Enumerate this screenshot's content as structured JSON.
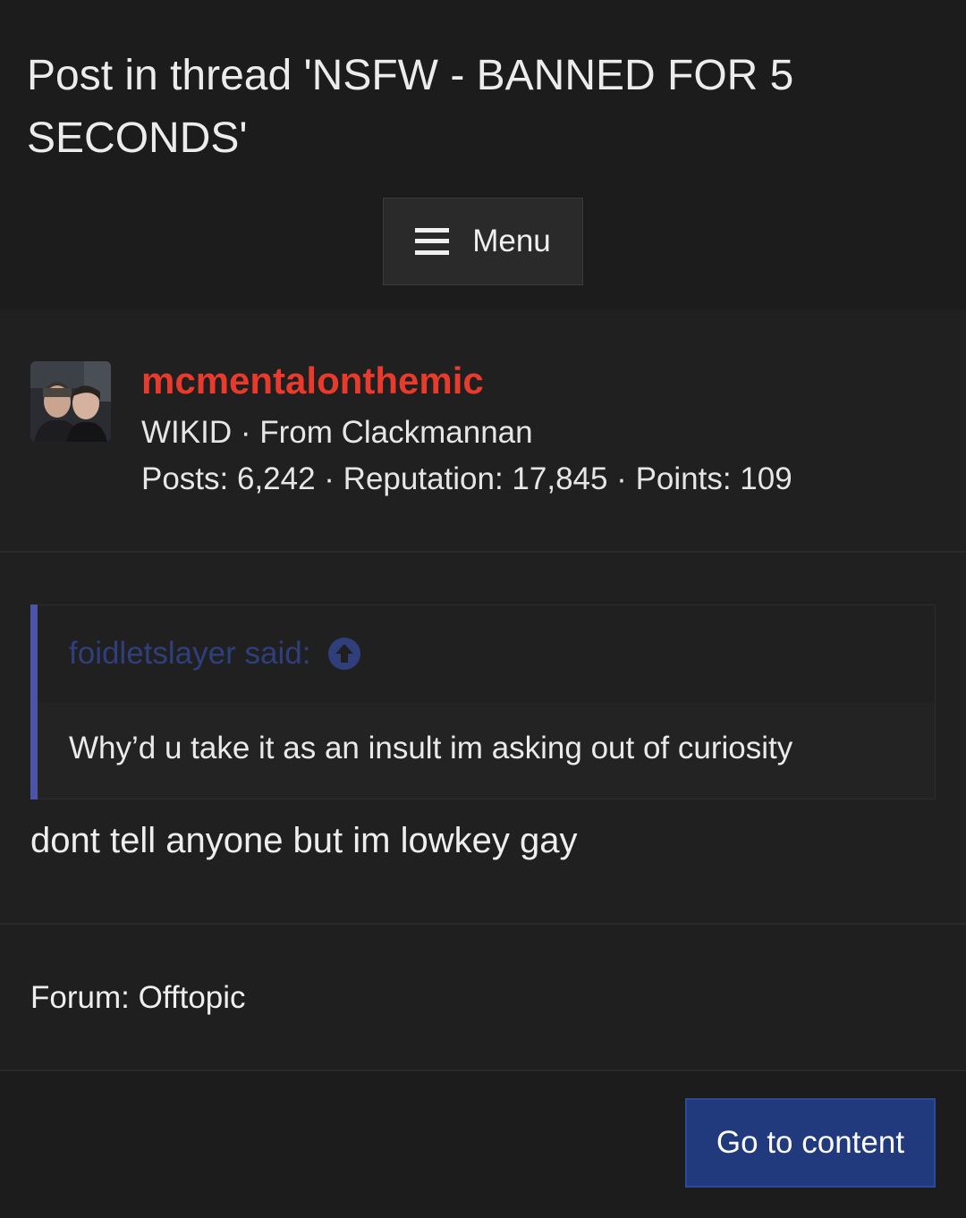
{
  "header": {
    "title": "Post in thread 'NSFW - BANNED FOR 5 SECONDS'",
    "menu_label": "Menu"
  },
  "user": {
    "username": "mcmentalonthemic",
    "meta": "WIKID · From Clackmannan",
    "stats": "Posts: 6,242 · Reputation: 17,845 · Points: 109",
    "username_color": "#ea3a2c"
  },
  "post": {
    "quote_author": "foidletslayer said:",
    "quote_text": "Why’d u take it as an insult im asking out of curiosity",
    "body": "dont tell anyone but im lowkey gay",
    "quote_accent": "#4a55a8"
  },
  "forum": {
    "label": "Forum: Offtopic"
  },
  "footer": {
    "go_to_content": "Go to content",
    "button_color": "#21397d"
  }
}
